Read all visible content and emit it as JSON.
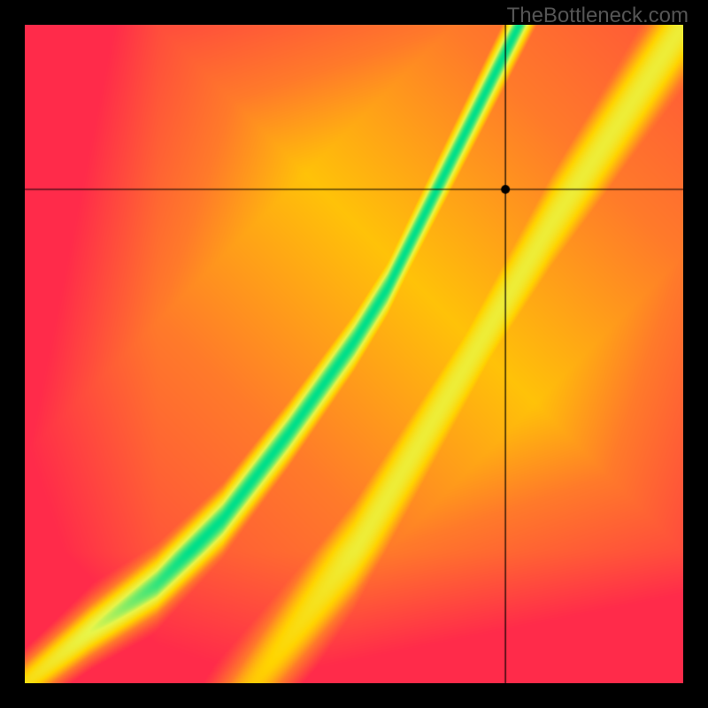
{
  "watermark": "TheBottleneck.com",
  "chart_data": {
    "type": "heatmap",
    "title": "",
    "xlabel": "",
    "ylabel": "",
    "xlim": [
      0,
      100
    ],
    "ylim": [
      0,
      100
    ],
    "crosshair": {
      "x": 73,
      "y": 75
    },
    "marker": {
      "x": 73,
      "y": 75
    },
    "optimal_ridge": [
      [
        0,
        0
      ],
      [
        10,
        8
      ],
      [
        20,
        15
      ],
      [
        30,
        25
      ],
      [
        40,
        38
      ],
      [
        50,
        52
      ],
      [
        55,
        60
      ],
      [
        60,
        70
      ],
      [
        65,
        80
      ],
      [
        70,
        90
      ],
      [
        75,
        100
      ]
    ],
    "second_ridge": [
      [
        35,
        0
      ],
      [
        50,
        20
      ],
      [
        65,
        45
      ],
      [
        80,
        70
      ],
      [
        100,
        100
      ]
    ],
    "color_scale": {
      "low": "#ff2b4a",
      "mid_low": "#ff7a2a",
      "mid": "#ffd400",
      "mid_high": "#e8f54a",
      "high": "#00df8a"
    }
  }
}
